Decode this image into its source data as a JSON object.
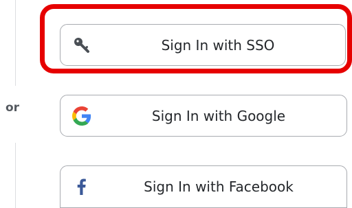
{
  "separator": {
    "or_label": "or"
  },
  "buttons": [
    {
      "id": "sso",
      "label": "Sign In with SSO",
      "icon": "key-icon",
      "highlighted": true
    },
    {
      "id": "google",
      "label": "Sign In with Google",
      "icon": "google-icon"
    },
    {
      "id": "facebook",
      "label": "Sign In with Facebook",
      "icon": "facebook-icon"
    }
  ],
  "colors": {
    "highlight": "#e60000",
    "button_border": "#a8abb0",
    "text": "#24272b",
    "facebook_blue": "#3b5998",
    "google_blue": "#4285f4",
    "google_red": "#ea4335",
    "google_yellow": "#fbbc05",
    "google_green": "#34a853"
  }
}
